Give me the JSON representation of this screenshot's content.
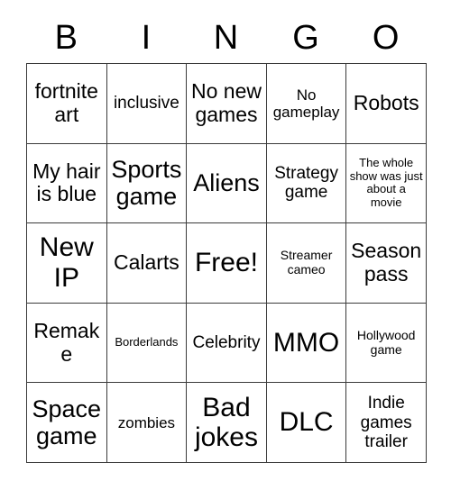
{
  "card": {
    "title_letters": [
      "B",
      "I",
      "N",
      "G",
      "O"
    ],
    "columns": 5,
    "rows": 5,
    "free_space": "Free!",
    "colors": {
      "background": "#ffffff",
      "grid_line": "#3a3a3a",
      "text": "#000000"
    },
    "cells": [
      [
        {
          "text": "fortnite art",
          "size": "fs-md"
        },
        {
          "text": "inclusive",
          "size": "fs-sm"
        },
        {
          "text": "No new games",
          "size": "fs-md"
        },
        {
          "text": "No gameplay",
          "size": "fs-xs"
        },
        {
          "text": "Robots",
          "size": "fs-md"
        }
      ],
      [
        {
          "text": "My hair is blue",
          "size": "fs-md"
        },
        {
          "text": "Sports game",
          "size": "fs-lg"
        },
        {
          "text": "Aliens",
          "size": "fs-lg"
        },
        {
          "text": "Strategy game",
          "size": "fs-sm"
        },
        {
          "text": "The whole show was just about a movie",
          "size": "fs-tiny"
        }
      ],
      [
        {
          "text": "New IP",
          "size": "fs-xl"
        },
        {
          "text": "Calarts",
          "size": "fs-md"
        },
        {
          "text": "Free!",
          "size": "fs-xl"
        },
        {
          "text": "Streamer cameo",
          "size": "fs-xxs"
        },
        {
          "text": "Season pass",
          "size": "fs-md"
        }
      ],
      [
        {
          "text": "Remake",
          "size": "fs-md"
        },
        {
          "text": "Borderlands",
          "size": "fs-tiny"
        },
        {
          "text": "Celebrity",
          "size": "fs-sm"
        },
        {
          "text": "MMO",
          "size": "fs-xl"
        },
        {
          "text": "Hollywood game",
          "size": "fs-xxs"
        }
      ],
      [
        {
          "text": "Space game",
          "size": "fs-lg"
        },
        {
          "text": "zombies",
          "size": "fs-xs"
        },
        {
          "text": "Bad jokes",
          "size": "fs-xl"
        },
        {
          "text": "DLC",
          "size": "fs-xl"
        },
        {
          "text": "Indie games trailer",
          "size": "fs-sm"
        }
      ]
    ]
  }
}
